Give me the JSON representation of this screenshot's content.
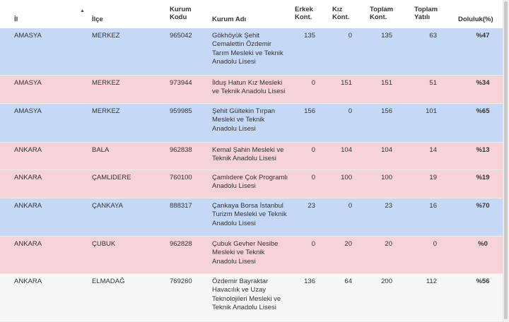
{
  "headers": {
    "il": "İl",
    "ilce": "İlçe",
    "kurum_kodu": "Kurum Kodu",
    "kurum_adi": "Kurum Adı",
    "erkek": "Erkek Kont.",
    "kiz": "Kız Kont.",
    "toplam_kont": "Toplam Kont.",
    "toplam_yatili": "Toplam Yatılı",
    "doluluk": "Doluluk(%)"
  },
  "sort_icon": "sort-ascending-icon",
  "colors": {
    "blue_row": "#c5d9f6",
    "pink_row": "#f6d3d8",
    "white_row": "#f7f7f7"
  },
  "rows": [
    {
      "il": "AMASYA",
      "ilce": "MERKEZ",
      "kod": "965042",
      "ad": "Gökhöyük Şehit Cemalettin Özdemir Tarım Mesleki ve Teknik Anadolu Lisesi",
      "erkek": "135",
      "kiz": "0",
      "toplam": "135",
      "yatili": "63",
      "doluluk": "%47"
    },
    {
      "il": "AMASYA",
      "ilce": "MERKEZ",
      "kod": "973944",
      "ad": "İlduş Hatun Kız Mesleki ve Teknik Anadolu Lisesi",
      "erkek": "0",
      "kiz": "151",
      "toplam": "151",
      "yatili": "51",
      "doluluk": "%34"
    },
    {
      "il": "AMASYA",
      "ilce": "MERKEZ",
      "kod": "959985",
      "ad": "Şehit Gültekin Tırpan Mesleki ve Teknik Anadolu Lisesi",
      "erkek": "156",
      "kiz": "0",
      "toplam": "156",
      "yatili": "101",
      "doluluk": "%65"
    },
    {
      "il": "ANKARA",
      "ilce": "BALA",
      "kod": "962838",
      "ad": "Kemal Şahin Mesleki ve Teknik Anadolu Lisesi",
      "erkek": "0",
      "kiz": "104",
      "toplam": "104",
      "yatili": "14",
      "doluluk": "%13"
    },
    {
      "il": "ANKARA",
      "ilce": "ÇAMLIDERE",
      "kod": "760100",
      "ad": "Çamlıdere Çok Programlı Anadolu Lisesi",
      "erkek": "0",
      "kiz": "100",
      "toplam": "100",
      "yatili": "19",
      "doluluk": "%19"
    },
    {
      "il": "ANKARA",
      "ilce": "ÇANKAYA",
      "kod": "888317",
      "ad": "Çankaya Borsa İstanbul Turizm Mesleki ve Teknik Anadolu Lisesi",
      "erkek": "23",
      "kiz": "0",
      "toplam": "23",
      "yatili": "16",
      "doluluk": "%70"
    },
    {
      "il": "ANKARA",
      "ilce": "ÇUBUK",
      "kod": "962828",
      "ad": "Çubuk Gevher Nesibe Mesleki ve Teknik Anadolu Lisesi",
      "erkek": "0",
      "kiz": "20",
      "toplam": "20",
      "yatili": "0",
      "doluluk": "%0"
    },
    {
      "il": "ANKARA",
      "ilce": "ELMADAĞ",
      "kod": "769260",
      "ad": "Özdemir Bayraktar Havacılık ve Uzay Teknolojileri Mesleki ve Teknik Anadolu Lisesi",
      "erkek": "136",
      "kiz": "64",
      "toplam": "200",
      "yatili": "112",
      "doluluk": "%56"
    }
  ]
}
